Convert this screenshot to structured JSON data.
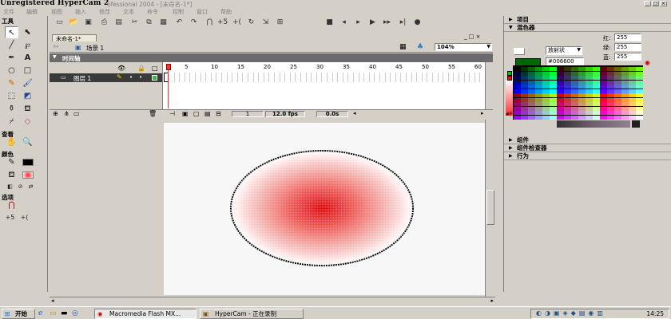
{
  "title_bar": {
    "title": "Unregistered HyperCam 2",
    "subtitle": "ofessional 2004 - [未命名-1*]"
  },
  "menu": [
    "文件",
    "编辑",
    "视图",
    "插入",
    "修改",
    "文本",
    "命令",
    "控制",
    "窗口",
    "帮助"
  ],
  "tools": {
    "header": "工具",
    "view_label": "查看",
    "colors_label": "颜色",
    "options_label": "选项"
  },
  "document": {
    "tab_label": "未命名-1*",
    "scene_label": "场景 1",
    "zoom": "104%"
  },
  "timeline": {
    "header": "时间轴",
    "layer_name": "图层 1",
    "ruler": [
      "1",
      "5",
      "10",
      "15",
      "20",
      "25",
      "30",
      "35",
      "40",
      "45",
      "50",
      "55",
      "60"
    ],
    "current_frame": "1",
    "fps": "12.0 fps",
    "elapsed": "0.0s"
  },
  "stage": {
    "gradient_center": "#ff0000",
    "gradient_edge": "#ffffff",
    "stroke_color": "#000000"
  },
  "panel": {
    "items_label": "项目",
    "mixer_label": "混色器",
    "red_label": "红:",
    "red_value": "255",
    "green_label": "绿:",
    "green_value": "255",
    "blue_label": "蓝:",
    "blue_value": "255",
    "fill_type": "放射状",
    "hex_value": "#006600",
    "swatch_color": "#006600",
    "components_label": "组件",
    "inspector_label": "组件检查器",
    "behaviors_label": "行为"
  },
  "taskbar": {
    "start_label": "开始",
    "task1": "Macromedia Flash MX...",
    "task2": "HyperCam - 正在录制",
    "clock": "14:25"
  }
}
